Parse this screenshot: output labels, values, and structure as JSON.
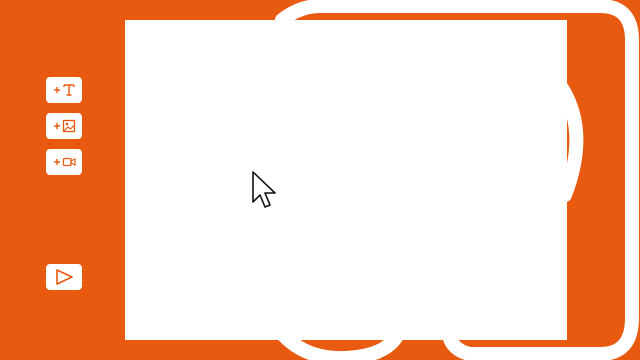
{
  "colors": {
    "background": "#E85A0F",
    "surface": "#ffffff",
    "icon": "#E85A0F",
    "cursor_fill": "#ffffff",
    "cursor_stroke": "#111111"
  },
  "toolbar": {
    "items": [
      {
        "icon": "add-text-icon"
      },
      {
        "icon": "add-image-icon"
      },
      {
        "icon": "add-video-icon"
      }
    ],
    "play": {
      "icon": "play-icon"
    }
  },
  "canvas": {
    "state": "empty"
  }
}
